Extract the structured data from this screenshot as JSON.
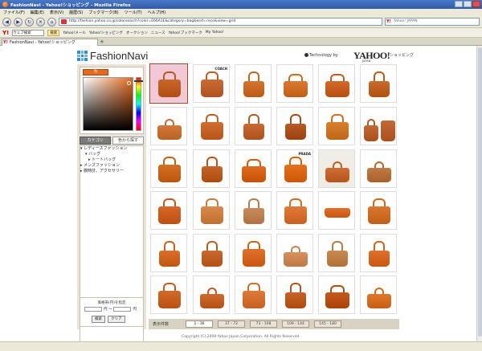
{
  "browser": {
    "window_title": "FashionNavi - Yahoo!ショッピング - Mozilla Firefox",
    "menu": [
      "ファイル(F)",
      "編集(E)",
      "表示(V)",
      "履歴(S)",
      "ブックマーク(B)",
      "ツール(T)",
      "ヘルプ(H)"
    ],
    "url": "http://fashion.yahoo.co.jp/colorsearch?color=E66A1E&category=bag&sort=reco&view=grid",
    "search_placeholder": "Yahoo! JAPAN",
    "tab_label": "FashionNavi - Yahoo!ショッピング",
    "toolbar": {
      "select_value": "ウェブ検索",
      "search_button": "検索",
      "links": [
        "Yahoo!メール",
        "Yahoo!ショッピング",
        "オークション",
        "ニュース",
        "Yahoo!ブックマーク",
        "My Yahoo!"
      ]
    }
  },
  "page": {
    "logo_text": "FashionNavi",
    "powered_by": "Technology by",
    "partner_logo": "YAHOO!",
    "partner_logo_sub": "JAPAN",
    "partner_tag": "ショッピング",
    "color_picker": {
      "swatch_label": "色",
      "selected_color": "#e66a1e"
    },
    "category_tabs": [
      "カテゴリ",
      "色から探す"
    ],
    "categories": [
      {
        "label": "レディースファッション",
        "level": 0
      },
      {
        "label": "バッグ",
        "level": 1
      },
      {
        "label": "トートバッグ",
        "level": 2
      },
      {
        "label": "メンズファッション",
        "level": 0
      },
      {
        "label": "腕時計、アクセサリー",
        "level": 0
      }
    ],
    "price": {
      "label": "価格帯(円)を指定",
      "min_suffix": "円 〜",
      "max_suffix": "円",
      "search_button": "検索",
      "clear_button": "クリア"
    },
    "pagination": {
      "label": "表示件数",
      "pages": [
        "1 - 36",
        "37 - 72",
        "73 - 108",
        "109 - 144",
        "145 - 180"
      ],
      "active_index": 0
    },
    "footer_text": "Copyright (C) 2009 Yahoo Japan Corporation. All Rights Reserved."
  },
  "products": {
    "count": 36,
    "selected_index": 0,
    "items": [
      {
        "shape": "tote",
        "color": "#c9672b",
        "bg": "#f4c7d6",
        "label": ""
      },
      {
        "shape": "tote",
        "color": "#c96b36",
        "bg": "#fff",
        "label": "COACH"
      },
      {
        "shape": "hobo",
        "color": "#d6742f",
        "bg": "#fff",
        "label": ""
      },
      {
        "shape": "basket",
        "color": "#d9782e",
        "bg": "#fff",
        "label": ""
      },
      {
        "shape": "basket",
        "color": "#d2692a",
        "bg": "#fff",
        "label": ""
      },
      {
        "shape": "hobo",
        "color": "#c96a2a",
        "bg": "#fff",
        "label": ""
      },
      {
        "shape": "satchel",
        "color": "#d27a3c",
        "bg": "#fff",
        "label": ""
      },
      {
        "shape": "tote",
        "color": "#cf6e30",
        "bg": "#fff",
        "label": ""
      },
      {
        "shape": "hobo",
        "color": "#c86a34",
        "bg": "#fff",
        "label": ""
      },
      {
        "shape": "hobo",
        "color": "#b75b26",
        "bg": "#fff",
        "label": ""
      },
      {
        "shape": "tote",
        "color": "#d8802f",
        "bg": "#fff",
        "label": ""
      },
      {
        "shape": "duo",
        "color": "#c26936",
        "bg": "#fff",
        "label": ""
      },
      {
        "shape": "tote",
        "color": "#d46f24",
        "bg": "#fff",
        "label": ""
      },
      {
        "shape": "hobo",
        "color": "#c76428",
        "bg": "#fff",
        "label": ""
      },
      {
        "shape": "basket",
        "color": "#e06a1e",
        "bg": "#fff",
        "label": ""
      },
      {
        "shape": "tote",
        "color": "#e5701e",
        "bg": "#fff",
        "label": "PRADA"
      },
      {
        "shape": "satchel",
        "color": "#cf6e34",
        "bg": "#f0ece6",
        "label": ""
      },
      {
        "shape": "satchel",
        "color": "#c27a44",
        "bg": "#fff",
        "label": ""
      },
      {
        "shape": "tote",
        "color": "#d6682a",
        "bg": "#fff",
        "label": ""
      },
      {
        "shape": "tote",
        "color": "#d98a4a",
        "bg": "#fff",
        "label": ""
      },
      {
        "shape": "hobo",
        "color": "#c98a5c",
        "bg": "#fff",
        "label": ""
      },
      {
        "shape": "tote",
        "color": "#e07a38",
        "bg": "#fff",
        "label": ""
      },
      {
        "shape": "clutch",
        "color": "#e0702c",
        "bg": "#fff",
        "label": ""
      },
      {
        "shape": "tote",
        "color": "#d9782e",
        "bg": "#fff",
        "label": ""
      },
      {
        "shape": "hobo",
        "color": "#d8702a",
        "bg": "#fff",
        "label": ""
      },
      {
        "shape": "hobo",
        "color": "#c9692e",
        "bg": "#fff",
        "label": ""
      },
      {
        "shape": "tote",
        "color": "#e0702a",
        "bg": "#fff",
        "label": ""
      },
      {
        "shape": "satchel",
        "color": "#d8915e",
        "bg": "#fff",
        "label": ""
      },
      {
        "shape": "hobo",
        "color": "#c88a4e",
        "bg": "#fff",
        "label": ""
      },
      {
        "shape": "hobo",
        "color": "#e0702a",
        "bg": "#fff",
        "label": ""
      },
      {
        "shape": "tote",
        "color": "#d26a2a",
        "bg": "#fff",
        "label": ""
      },
      {
        "shape": "satchel",
        "color": "#cf6a2e",
        "bg": "#fff",
        "label": ""
      },
      {
        "shape": "tote",
        "color": "#e07a3a",
        "bg": "#fff",
        "label": ""
      },
      {
        "shape": "hobo",
        "color": "#c86226",
        "bg": "#fff",
        "label": ""
      },
      {
        "shape": "basket",
        "color": "#c45a20",
        "bg": "#fff",
        "label": ""
      },
      {
        "shape": "satchel",
        "color": "#e0782c",
        "bg": "#fff",
        "label": ""
      }
    ]
  }
}
